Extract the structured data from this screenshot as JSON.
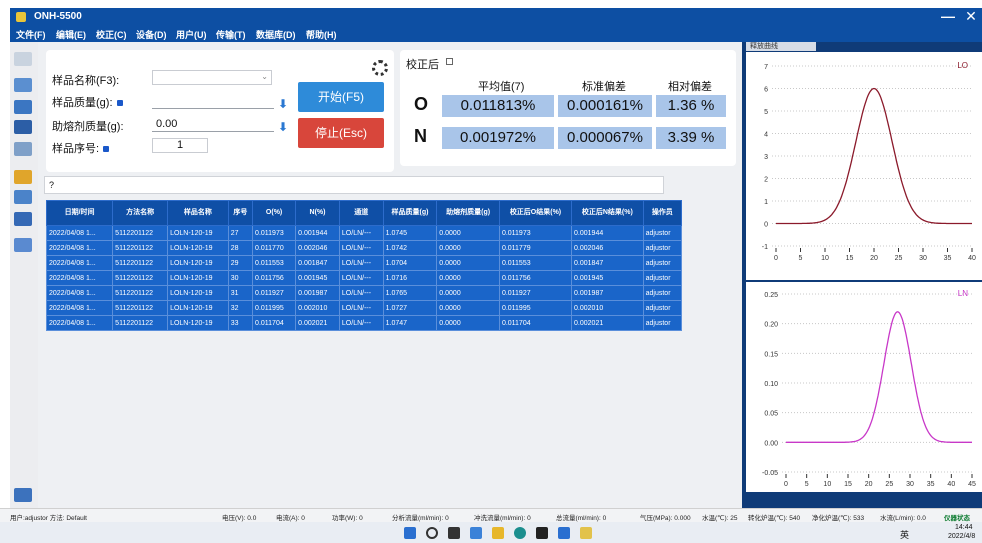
{
  "app": {
    "title": "ONH-5500"
  },
  "menu": [
    "文件(F)",
    "编辑(E)",
    "校正(C)",
    "设备(D)",
    "用户(U)",
    "传输(T)",
    "数据库(D)",
    "帮助(H)"
  ],
  "form": {
    "sample_name_label": "样品名称(F3):",
    "sample_mass_label": "样品质量(g):",
    "flux_mass_label": "助熔剂质量(g):",
    "flux_mass_value": "0.00",
    "sample_no_label": "样品序号:",
    "sample_no_value": "1",
    "start_button": "开始(F5)",
    "stop_button": "停止(Esc)"
  },
  "results": {
    "after_correction_label": "校正后",
    "headers": [
      "平均值(7)",
      "标准偏差",
      "相对偏差"
    ],
    "rows": [
      {
        "element": "O",
        "mean": "0.011813%",
        "std": "0.000161%",
        "rsd": "1.36 %"
      },
      {
        "element": "N",
        "mean": "0.001972%",
        "std": "0.000067%",
        "rsd": "3.39 %"
      }
    ]
  },
  "search": {
    "text": "?"
  },
  "table": {
    "headers": [
      "日期/时间",
      "方法名称",
      "样品名称",
      "序号",
      "O(%)",
      "N(%)",
      "通道",
      "样品质量(g)",
      "助熔剂质量(g)",
      "校正后O结果(%)",
      "校正后N结果(%)",
      "操作员"
    ],
    "rows": [
      [
        "2022/04/08 1...",
        "5112201122",
        "LOLN-120-19",
        "27",
        "0.011973",
        "0.001944",
        "LO/LN/---",
        "1.0745",
        "0.0000",
        "0.011973",
        "0.001944",
        "adjustor"
      ],
      [
        "2022/04/08 1...",
        "5112201122",
        "LOLN-120-19",
        "28",
        "0.011770",
        "0.002046",
        "LO/LN/---",
        "1.0742",
        "0.0000",
        "0.011779",
        "0.002046",
        "adjustor"
      ],
      [
        "2022/04/08 1...",
        "5112201122",
        "LOLN-120-19",
        "29",
        "0.011553",
        "0.001847",
        "LO/LN/---",
        "1.0704",
        "0.0000",
        "0.011553",
        "0.001847",
        "adjustor"
      ],
      [
        "2022/04/08 1...",
        "5112201122",
        "LOLN-120-19",
        "30",
        "0.011756",
        "0.001945",
        "LO/LN/---",
        "1.0716",
        "0.0000",
        "0.011756",
        "0.001945",
        "adjustor"
      ],
      [
        "2022/04/08 1...",
        "5112201122",
        "LOLN-120-19",
        "31",
        "0.011927",
        "0.001987",
        "LO/LN/---",
        "1.0765",
        "0.0000",
        "0.011927",
        "0.001987",
        "adjustor"
      ],
      [
        "2022/04/08 1...",
        "5112201122",
        "LOLN-120-19",
        "32",
        "0.011995",
        "0.002010",
        "LO/LN/---",
        "1.0727",
        "0.0000",
        "0.011995",
        "0.002010",
        "adjustor"
      ],
      [
        "2022/04/08 1...",
        "5112201122",
        "LOLN-120-19",
        "33",
        "0.011704",
        "0.002021",
        "LO/LN/---",
        "1.0747",
        "0.0000",
        "0.011704",
        "0.002021",
        "adjustor"
      ]
    ]
  },
  "curves": {
    "tab_label": "释放曲线",
    "top": {
      "legend": "LO",
      "color": "#8b1a2b",
      "y_ticks": [
        "7",
        "6",
        "5",
        "4",
        "3",
        "2",
        "1",
        "0",
        "-1"
      ],
      "x_ticks": [
        "0",
        "5",
        "10",
        "15",
        "20",
        "25",
        "30",
        "35",
        "40"
      ],
      "ylim": [
        -1,
        7
      ],
      "xlim": [
        0,
        40
      ],
      "peak_x": 20,
      "peak_y": 6,
      "sigma": 3.7
    },
    "bottom": {
      "legend": "LN",
      "color": "#c838c8",
      "y_ticks": [
        "0.25",
        "0.20",
        "0.15",
        "0.10",
        "0.05",
        "0.00",
        "-0.05"
      ],
      "x_ticks": [
        "0",
        "5",
        "10",
        "15",
        "20",
        "25",
        "30",
        "35",
        "40",
        "45"
      ],
      "ylim": [
        -0.05,
        0.25
      ],
      "xlim": [
        0,
        45
      ],
      "peak_x": 27,
      "peak_y": 0.22,
      "sigma": 3.3
    }
  },
  "status": [
    "用户:adjustor  方法: Default",
    "电压(V): 0.0",
    "电流(A): 0",
    "功率(W): 0",
    "分析流量(ml/min): 0",
    "冲洗流量(ml/min): 0",
    "总流量(ml/min): 0",
    "气压(MPa): 0.000",
    "水温(℃): 25",
    "转化炉温(℃): 540",
    "净化炉温(℃): 533",
    "水流(L/min): 0.0",
    "仪器状态"
  ],
  "taskbar": {
    "time": "14:44",
    "date": "2022/4/8",
    "lang": "英"
  }
}
